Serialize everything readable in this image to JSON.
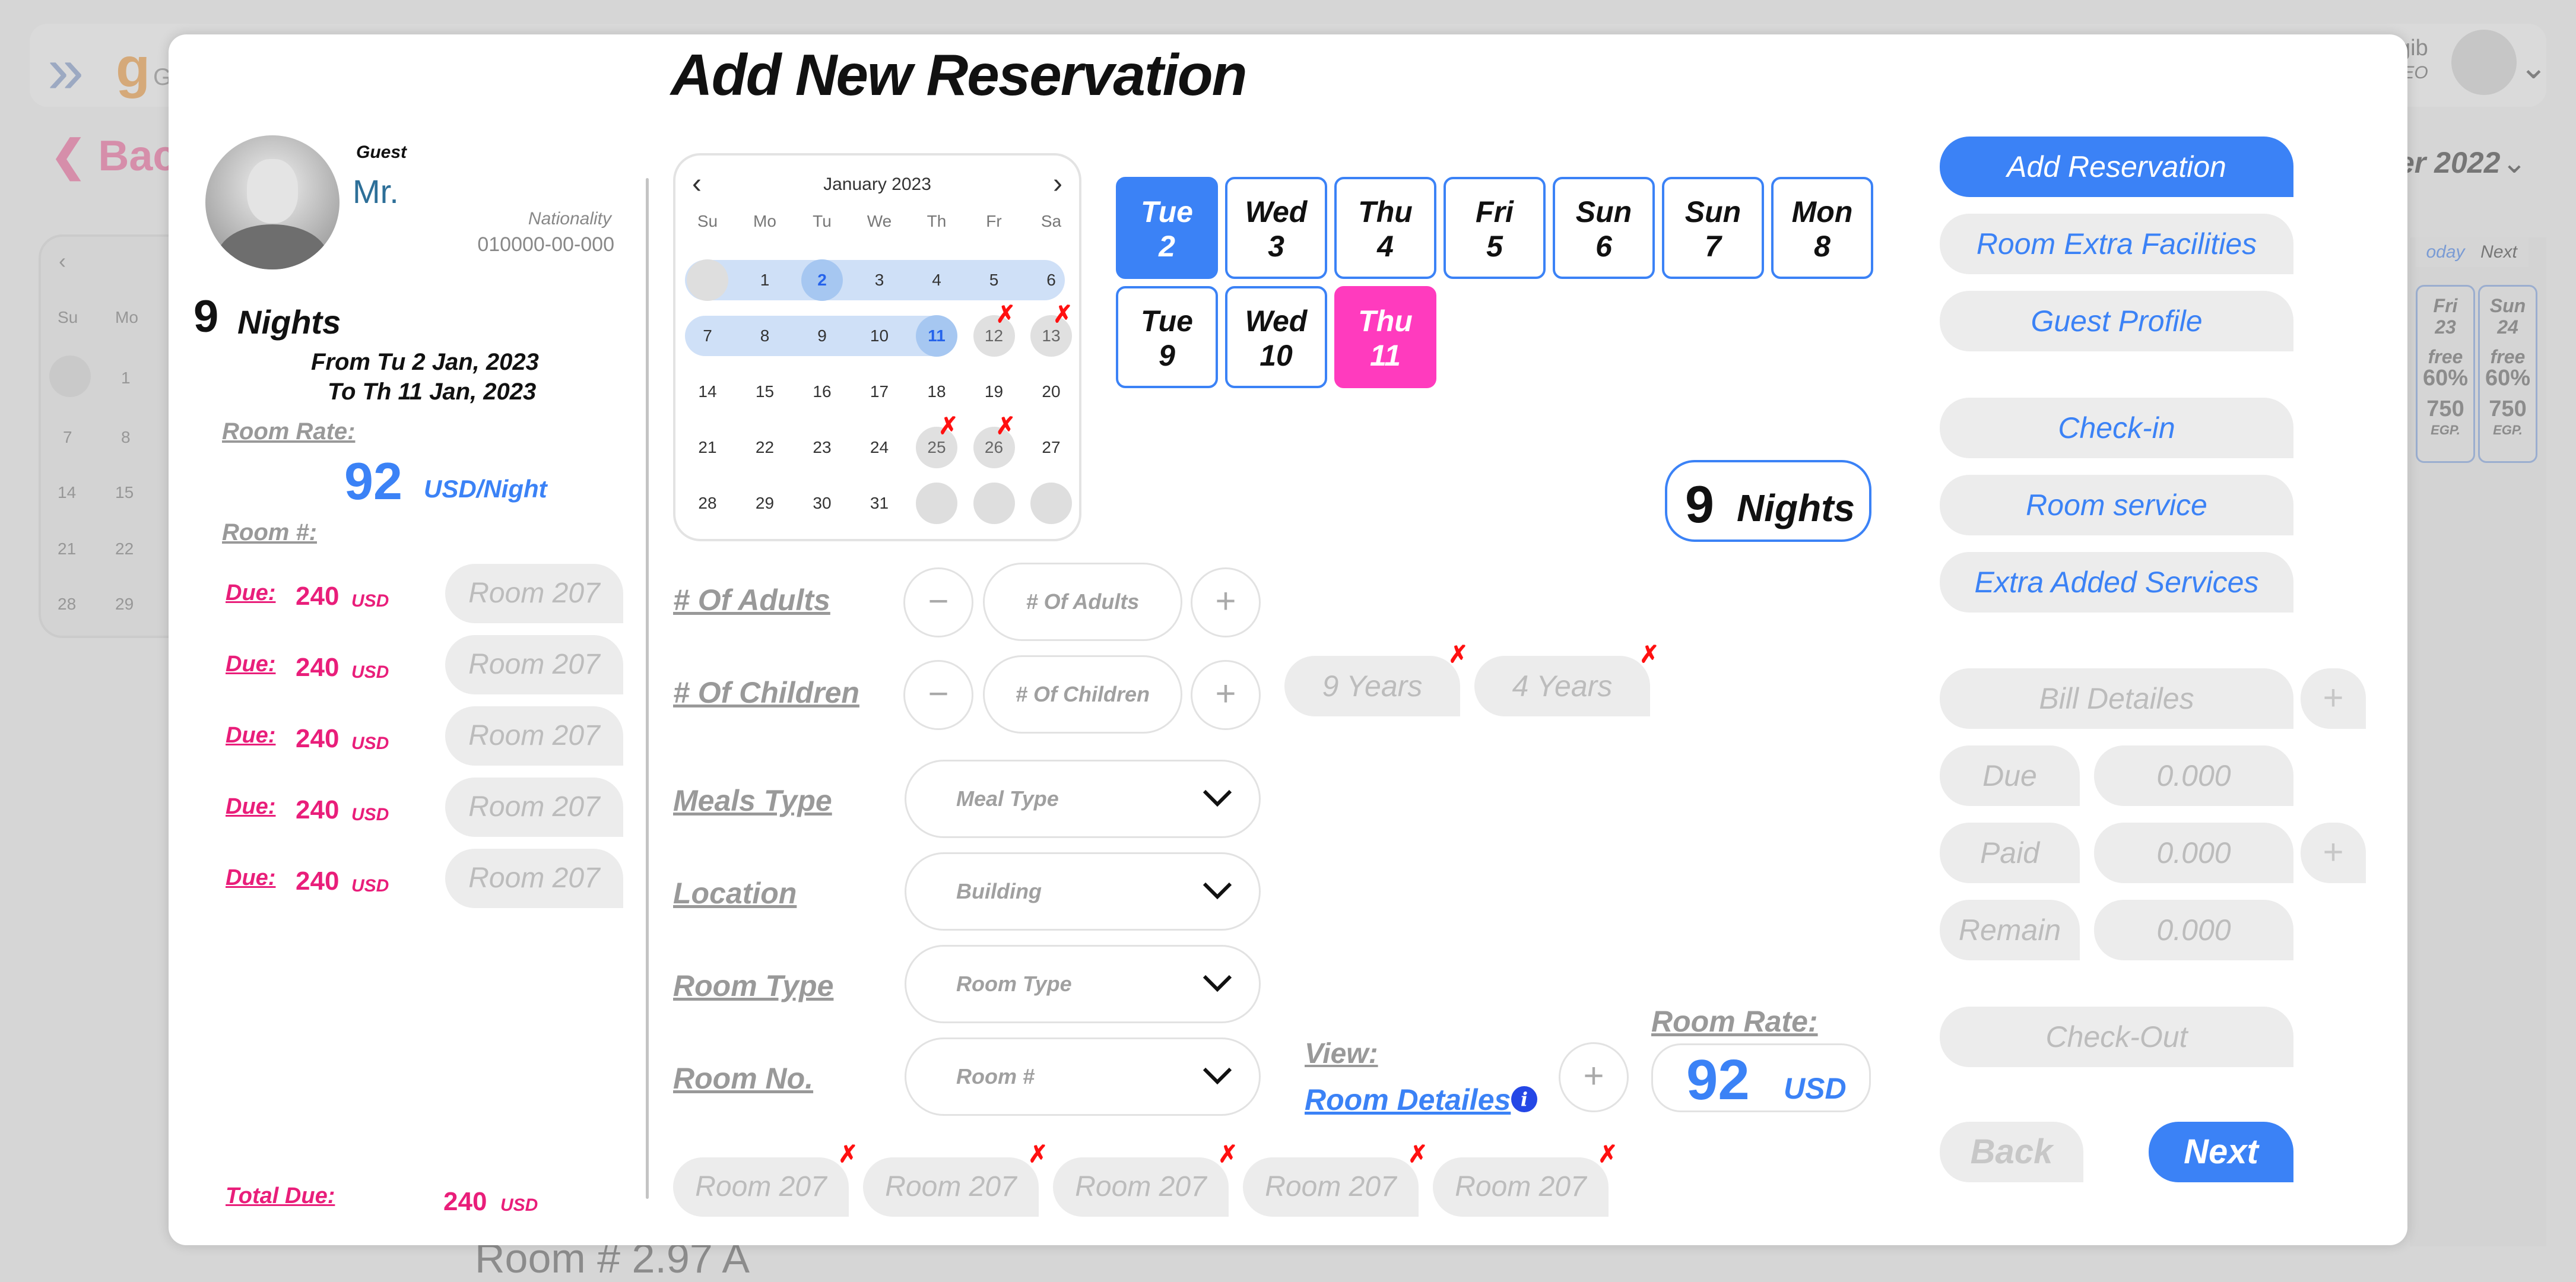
{
  "background": {
    "user_name": "gib",
    "user_role": "EO",
    "back_label": "Back",
    "month_label": "er 2022",
    "tabs": [
      "oday",
      "Next"
    ],
    "day_columns": [
      {
        "day": "Fri",
        "date": "23",
        "free": "free",
        "pct": "60%",
        "price": "750",
        "cur": "EGP."
      },
      {
        "day": "Sun",
        "date": "24",
        "free": "free",
        "pct": "60%",
        "price": "750",
        "cur": "EGP."
      }
    ],
    "mini_cal": {
      "dow": [
        "Su",
        "Mo"
      ],
      "rows": [
        [
          "",
          "1"
        ],
        [
          "7",
          "8"
        ],
        [
          "14",
          "15"
        ],
        [
          "21",
          "22"
        ],
        [
          "28",
          "29"
        ]
      ]
    },
    "footer_text": "Room # 2.97 A"
  },
  "modal": {
    "title": "Add New Reservation",
    "guest": {
      "label": "Guest",
      "name": "Mr.",
      "nationality_label": "Nationality",
      "nationality_value": "010000-00-000"
    },
    "stay": {
      "nights": "9",
      "nights_label": "Nights",
      "from": "From Tu 2 Jan, 2023",
      "to": "To Th 11 Jan, 2023"
    },
    "room_rate_label": "Room Rate:",
    "room_rate_value": "92",
    "room_rate_unit": "USD/Night",
    "room_no_label": "Room #:",
    "dues": [
      {
        "label": "Due:",
        "amount": "240",
        "currency": "USD",
        "room": "Room 207"
      },
      {
        "label": "Due:",
        "amount": "240",
        "currency": "USD",
        "room": "Room 207"
      },
      {
        "label": "Due:",
        "amount": "240",
        "currency": "USD",
        "room": "Room 207"
      },
      {
        "label": "Due:",
        "amount": "240",
        "currency": "USD",
        "room": "Room 207"
      },
      {
        "label": "Due:",
        "amount": "240",
        "currency": "USD",
        "room": "Room 207"
      }
    ],
    "total_due_label": "Total Due:",
    "total_due_amount": "240",
    "total_due_currency": "USD",
    "calendar": {
      "month": "January 2023",
      "dow": [
        "Su",
        "Mo",
        "Tu",
        "We",
        "Th",
        "Fr",
        "Sa"
      ],
      "weeks": [
        [
          "",
          "1",
          "2",
          "3",
          "4",
          "5",
          "6"
        ],
        [
          "7",
          "8",
          "9",
          "10",
          "11",
          "12",
          "13"
        ],
        [
          "14",
          "15",
          "16",
          "17",
          "18",
          "19",
          "20"
        ],
        [
          "21",
          "22",
          "23",
          "24",
          "25",
          "26",
          "27"
        ],
        [
          "28",
          "29",
          "30",
          "31",
          "",
          "",
          ""
        ]
      ],
      "unavailable_mark": "✗"
    },
    "day_chips": [
      {
        "day": "Tue",
        "date": "2"
      },
      {
        "day": "Wed",
        "date": "3"
      },
      {
        "day": "Thu",
        "date": "4"
      },
      {
        "day": "Fri",
        "date": "5"
      },
      {
        "day": "Sun",
        "date": "6"
      },
      {
        "day": "Sun",
        "date": "7"
      },
      {
        "day": "Mon",
        "date": "8"
      },
      {
        "day": "Tue",
        "date": "9"
      },
      {
        "day": "Wed",
        "date": "10"
      },
      {
        "day": "Thu",
        "date": "11"
      }
    ],
    "nights_badge": {
      "value": "9",
      "label": "Nights"
    },
    "form": {
      "adults_label": "# Of Adults",
      "adults_placeholder": "# Of Adults",
      "children_label": "# Of Children",
      "children_placeholder": "# Of Children",
      "child_ages": [
        "9 Years",
        "4 Years"
      ],
      "meals_label": "Meals Type",
      "meals_value": "Meal Type",
      "location_label": "Location",
      "location_value": "Building",
      "room_type_label": "Room Type",
      "room_type_value": "Room Type",
      "room_no_label": "Room No.",
      "room_no_value": "Room #",
      "minus": "−",
      "plus": "+"
    },
    "view_label": "View:",
    "room_details_label": "Room Detailes",
    "info_glyph": "i",
    "rate_label": "Room Rate:",
    "rate_value": "92",
    "rate_unit": "USD",
    "selected_rooms": [
      "Room 207",
      "Room 207",
      "Room 207",
      "Room 207",
      "Room 207"
    ],
    "actions": {
      "add_reservation": "Add Reservation",
      "room_extra_facilities": "Room Extra Facilities",
      "guest_profile": "Guest Profile",
      "check_in": "Check-in",
      "room_service": "Room service",
      "extra_added_services": "Extra Added Services",
      "bill_details": "Bill Detailes",
      "due_label": "Due",
      "due_value": "0.000",
      "paid_label": "Paid",
      "paid_value": "0.000",
      "remain_label": "Remain",
      "remain_value": "0.000",
      "check_out": "Check-Out",
      "back": "Back",
      "next": "Next",
      "plus": "+"
    },
    "colors": {
      "primary": "#3b82f6",
      "accent_pink": "#ff3bbe",
      "due_pink": "#e91e7a",
      "cancel_red": "#ff1010"
    }
  }
}
